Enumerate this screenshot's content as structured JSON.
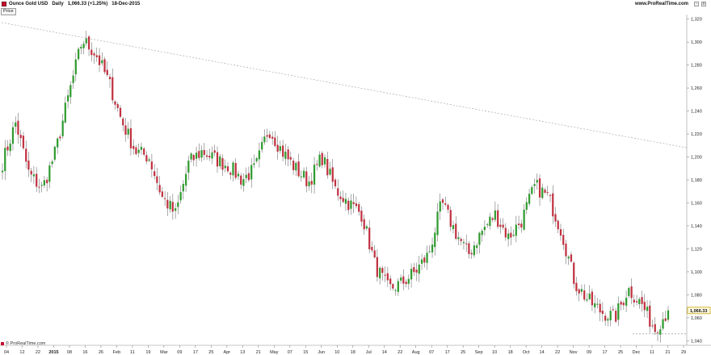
{
  "header": {
    "instrument": "Ounce Gold USD",
    "period": "Daily",
    "last_change": "1,066.33 (+1.25%)",
    "date": "18-Dec-2015",
    "brand": "www.ProRealTime.com",
    "window_buttons": [
      "-",
      "x"
    ]
  },
  "panel_label": "Price",
  "footer_brand": "© ProRealTime.com",
  "colors": {
    "up": "#2e9a2e",
    "down": "#c0303f",
    "trendline": "#aaaaaa",
    "price_tag_border": "#c8a400"
  },
  "chart_data": {
    "type": "candlestick",
    "price_axis_labels": [
      "1,320",
      "1,300",
      "1,280",
      "1,260",
      "1,240",
      "1,220",
      "1,200",
      "1,180",
      "1,160",
      "1,140",
      "1,120",
      "1,100",
      "1,080",
      "1,060",
      "1,040"
    ],
    "ylim": [
      1036,
      1324
    ],
    "current_price_label": "1,066.33",
    "date_axis_labels": [
      "04",
      "12",
      "22",
      "2015",
      "08",
      "16",
      "26",
      "Feb",
      "11",
      "19",
      "Mar",
      "09",
      "17",
      "25",
      "Apr",
      "13",
      "21",
      "May",
      "07",
      "15",
      "Jun",
      "10",
      "18",
      "Jul",
      "14",
      "22",
      "Aug",
      "07",
      "17",
      "25",
      "Sep",
      "10",
      "18",
      "Oct",
      "14",
      "22",
      "Nov",
      "09",
      "17",
      "25",
      "Dec",
      "11",
      "21",
      "29"
    ],
    "trendline": {
      "start": {
        "x": "Dec 2014",
        "y": 1317
      },
      "end": {
        "x": "Dec 2015",
        "y": 1208
      }
    },
    "support_line": {
      "y": 1046,
      "style": "dashed"
    },
    "series": [
      {
        "date": "2014-12",
        "close": 1195
      },
      {
        "date": "2014-12",
        "close": 1230
      },
      {
        "date": "2015-01-02",
        "close": 1185
      },
      {
        "date": "2015-01-07",
        "close": 1172
      },
      {
        "date": "2015-01-12",
        "close": 1205
      },
      {
        "date": "2015-01-16",
        "close": 1255
      },
      {
        "date": "2015-01-22",
        "close": 1302
      },
      {
        "date": "2015-01-26",
        "close": 1290
      },
      {
        "date": "2015-02-04",
        "close": 1265
      },
      {
        "date": "2015-02-11",
        "close": 1230
      },
      {
        "date": "2015-02-19",
        "close": 1205
      },
      {
        "date": "2015-03-02",
        "close": 1200
      },
      {
        "date": "2015-03-09",
        "close": 1165
      },
      {
        "date": "2015-03-17",
        "close": 1150
      },
      {
        "date": "2015-03-25",
        "close": 1195
      },
      {
        "date": "2015-04-02",
        "close": 1205
      },
      {
        "date": "2015-04-13",
        "close": 1198
      },
      {
        "date": "2015-04-21",
        "close": 1192
      },
      {
        "date": "2015-05-01",
        "close": 1180
      },
      {
        "date": "2015-05-07",
        "close": 1190
      },
      {
        "date": "2015-05-15",
        "close": 1225
      },
      {
        "date": "2015-05-22",
        "close": 1205
      },
      {
        "date": "2015-06-01",
        "close": 1190
      },
      {
        "date": "2015-06-10",
        "close": 1178
      },
      {
        "date": "2015-06-18",
        "close": 1200
      },
      {
        "date": "2015-06-26",
        "close": 1172
      },
      {
        "date": "2015-07-06",
        "close": 1160
      },
      {
        "date": "2015-07-14",
        "close": 1150
      },
      {
        "date": "2015-07-20",
        "close": 1105
      },
      {
        "date": "2015-07-24",
        "close": 1085
      },
      {
        "date": "2015-08-03",
        "close": 1090
      },
      {
        "date": "2015-08-10",
        "close": 1100
      },
      {
        "date": "2015-08-17",
        "close": 1115
      },
      {
        "date": "2015-08-24",
        "close": 1160
      },
      {
        "date": "2015-08-31",
        "close": 1135
      },
      {
        "date": "2015-09-10",
        "close": 1115
      },
      {
        "date": "2015-09-18",
        "close": 1135
      },
      {
        "date": "2015-09-25",
        "close": 1150
      },
      {
        "date": "2015-10-01",
        "close": 1130
      },
      {
        "date": "2015-10-08",
        "close": 1145
      },
      {
        "date": "2015-10-14",
        "close": 1175
      },
      {
        "date": "2015-10-22",
        "close": 1165
      },
      {
        "date": "2015-11-02",
        "close": 1135
      },
      {
        "date": "2015-11-09",
        "close": 1090
      },
      {
        "date": "2015-11-17",
        "close": 1075
      },
      {
        "date": "2015-11-25",
        "close": 1065
      },
      {
        "date": "2015-12-02",
        "close": 1060
      },
      {
        "date": "2015-12-07",
        "close": 1085
      },
      {
        "date": "2015-12-11",
        "close": 1072
      },
      {
        "date": "2015-12-17",
        "close": 1050
      },
      {
        "date": "2015-12-18",
        "close": 1066.33
      }
    ]
  }
}
